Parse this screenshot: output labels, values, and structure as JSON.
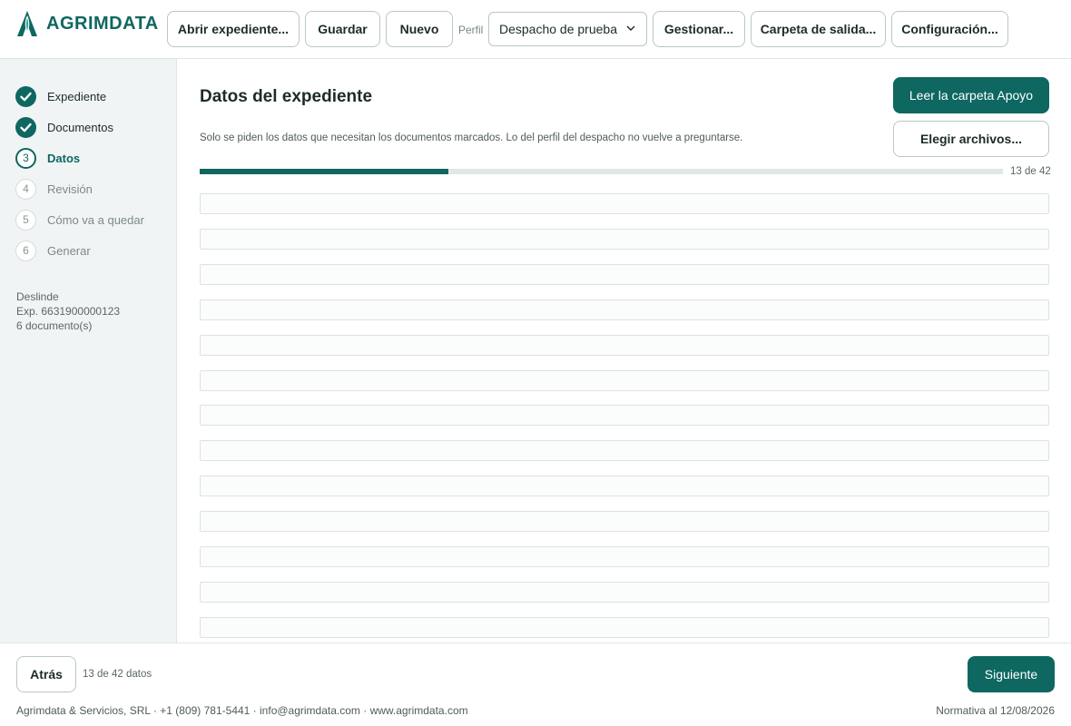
{
  "app": {
    "brand": "AGRIMDATA",
    "accent_color": "#0e6761"
  },
  "toolbar": {
    "open_label": "Abrir expediente...",
    "save_label": "Guardar",
    "new_label": "Nuevo",
    "perfil_label": "Perfil",
    "perfil_selected": "Despacho de prueba",
    "manage_label": "Gestionar...",
    "output_folder_label": "Carpeta de salida...",
    "config_label": "Configuración..."
  },
  "steps": [
    {
      "num": "1",
      "label": "Expediente",
      "state": "done"
    },
    {
      "num": "2",
      "label": "Documentos",
      "state": "done"
    },
    {
      "num": "3",
      "label": "Datos",
      "state": "current"
    },
    {
      "num": "4",
      "label": "Revisión",
      "state": "pending"
    },
    {
      "num": "5",
      "label": "Cómo va a quedar",
      "state": "pending"
    },
    {
      "num": "6",
      "label": "Generar",
      "state": "pending"
    }
  ],
  "expediente_info": {
    "type": "Deslinde",
    "number": "Exp. 6631900000123",
    "documents": "6 documento(s)"
  },
  "main": {
    "title": "Datos del expediente",
    "subtitle": "Solo se piden los datos que necesitan los documentos marcados. Lo del perfil del despacho no vuelve a preguntarse.",
    "read_support_label": "Leer la carpeta Apoyo",
    "choose_files_label": "Elegir archivos...",
    "progress_text": "13 de 42",
    "progress_fraction": 0.31
  },
  "fields": [
    {
      "value": ""
    },
    {
      "value": ""
    },
    {
      "value": ""
    },
    {
      "value": ""
    },
    {
      "value": ""
    },
    {
      "value": ""
    },
    {
      "value": ""
    },
    {
      "value": ""
    },
    {
      "value": ""
    },
    {
      "value": ""
    },
    {
      "value": ""
    },
    {
      "value": ""
    },
    {
      "value": ""
    }
  ],
  "footer": {
    "back_label": "Atrás",
    "count_text": "13 de 42 datos",
    "next_label": "Siguiente",
    "company": "Agrimdata & Servicios, SRL · +1 (809) 781-5441 · info@agrimdata.com · www.agrimdata.com",
    "normativa": "Normativa al 12/08/2026"
  }
}
